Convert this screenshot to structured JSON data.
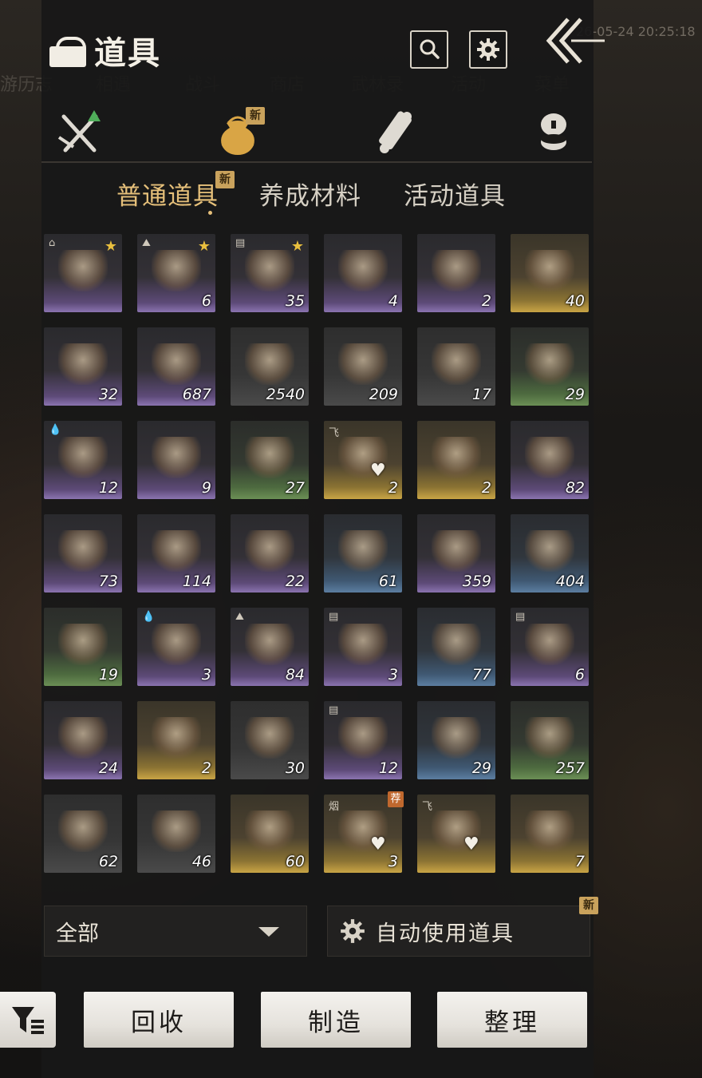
{
  "background": {
    "date_text": "26-05-24 20:25:18",
    "nav_items": [
      "游历志",
      "相遇",
      "战斗",
      "商店",
      "武林录",
      "活动",
      "菜单"
    ]
  },
  "header": {
    "title": "道具",
    "search_icon": "search-icon",
    "settings_icon": "gear-icon",
    "back_icon": "double-chevron-left-icon"
  },
  "category_tabs": [
    {
      "icon": "crossed-swords-icon",
      "active": false,
      "badge": ""
    },
    {
      "icon": "pouch-icon",
      "active": true,
      "badge": "新"
    },
    {
      "icon": "scroll-icon",
      "active": false,
      "badge": ""
    },
    {
      "icon": "coin-stack-icon",
      "active": false,
      "badge": ""
    }
  ],
  "sub_tabs": [
    {
      "label": "普通道具",
      "active": true,
      "badge": "新"
    },
    {
      "label": "养成材料",
      "active": false,
      "badge": ""
    },
    {
      "label": "活动道具",
      "active": false,
      "badge": ""
    }
  ],
  "items": [
    {
      "name": "bamboo-slips",
      "count": "",
      "rarity": "purple",
      "star": true,
      "tag": "house"
    },
    {
      "name": "bamboo-slips",
      "count": "6",
      "rarity": "purple",
      "star": true,
      "tag": "mountain"
    },
    {
      "name": "manual-page",
      "count": "35",
      "rarity": "purple",
      "star": true,
      "tag": "book"
    },
    {
      "name": "magnifier-chest",
      "count": "4",
      "rarity": "purple",
      "star": false,
      "tag": ""
    },
    {
      "name": "lantern-chest",
      "count": "2",
      "rarity": "purple",
      "star": false,
      "tag": ""
    },
    {
      "name": "treasure-chest",
      "count": "40",
      "rarity": "gold",
      "star": false,
      "tag": ""
    },
    {
      "name": "ornate-token",
      "count": "32",
      "rarity": "purple",
      "star": false,
      "tag": ""
    },
    {
      "name": "carved-chest",
      "count": "687",
      "rarity": "purple",
      "star": false,
      "tag": ""
    },
    {
      "name": "firewood",
      "count": "2540",
      "rarity": "grey",
      "star": false,
      "tag": ""
    },
    {
      "name": "iron-ore",
      "count": "209",
      "rarity": "grey",
      "star": false,
      "tag": ""
    },
    {
      "name": "animal-pelt",
      "count": "17",
      "rarity": "grey",
      "star": false,
      "tag": ""
    },
    {
      "name": "gravel-pile",
      "count": "29",
      "rarity": "green",
      "star": false,
      "tag": ""
    },
    {
      "name": "dumpling-soup",
      "count": "12",
      "rarity": "purple",
      "star": false,
      "tag": "drop"
    },
    {
      "name": "fabric-box",
      "count": "9",
      "rarity": "purple",
      "star": false,
      "tag": ""
    },
    {
      "name": "jade-pendant",
      "count": "27",
      "rarity": "green",
      "star": false,
      "tag": ""
    },
    {
      "name": "gift-chest",
      "count": "2",
      "rarity": "gold",
      "star": false,
      "tag": "飞",
      "heart": true
    },
    {
      "name": "spirit-shard",
      "count": "2",
      "rarity": "gold",
      "star": false,
      "tag": ""
    },
    {
      "name": "wardrobe-chest",
      "count": "82",
      "rarity": "purple",
      "star": false,
      "tag": ""
    },
    {
      "name": "soap-box",
      "count": "73",
      "rarity": "purple",
      "star": false,
      "tag": ""
    },
    {
      "name": "wardrobe-chest",
      "count": "114",
      "rarity": "purple",
      "star": false,
      "tag": ""
    },
    {
      "name": "red-envelope",
      "count": "22",
      "rarity": "purple",
      "star": false,
      "tag": ""
    },
    {
      "name": "painting-scroll",
      "count": "61",
      "rarity": "blue",
      "star": false,
      "tag": ""
    },
    {
      "name": "crane-medallion",
      "count": "359",
      "rarity": "purple",
      "star": false,
      "tag": ""
    },
    {
      "name": "dye-box",
      "count": "404",
      "rarity": "blue",
      "star": false,
      "tag": ""
    },
    {
      "name": "plum-blossom",
      "count": "19",
      "rarity": "green",
      "star": false,
      "tag": ""
    },
    {
      "name": "braised-dish",
      "count": "3",
      "rarity": "purple",
      "star": false,
      "tag": "drop"
    },
    {
      "name": "clay-pot-stew",
      "count": "84",
      "rarity": "purple",
      "star": false,
      "tag": "mountain"
    },
    {
      "name": "manual-page",
      "count": "3",
      "rarity": "purple",
      "star": false,
      "tag": "book"
    },
    {
      "name": "war-horn",
      "count": "77",
      "rarity": "blue",
      "star": false,
      "tag": ""
    },
    {
      "name": "manual-page",
      "count": "6",
      "rarity": "purple",
      "star": false,
      "tag": "book"
    },
    {
      "name": "seal-plaque",
      "count": "24",
      "rarity": "purple",
      "star": false,
      "tag": ""
    },
    {
      "name": "spirit-shard",
      "count": "2",
      "rarity": "gold",
      "star": false,
      "tag": ""
    },
    {
      "name": "wine-jar",
      "count": "30",
      "rarity": "grey",
      "star": false,
      "tag": ""
    },
    {
      "name": "manual-page",
      "count": "12",
      "rarity": "purple",
      "star": false,
      "tag": "book"
    },
    {
      "name": "porcelain-jar",
      "count": "29",
      "rarity": "blue",
      "star": false,
      "tag": ""
    },
    {
      "name": "purple-petals",
      "count": "257",
      "rarity": "green",
      "star": false,
      "tag": ""
    },
    {
      "name": "wild-fruit",
      "count": "62",
      "rarity": "grey",
      "star": false,
      "tag": ""
    },
    {
      "name": "seed-sack",
      "count": "46",
      "rarity": "grey",
      "star": false,
      "tag": ""
    },
    {
      "name": "treasure-chest",
      "count": "60",
      "rarity": "gold",
      "star": false,
      "tag": ""
    },
    {
      "name": "gift-chest",
      "count": "3",
      "rarity": "gold",
      "star": false,
      "tag": "烟",
      "heart": true,
      "rec": "荐"
    },
    {
      "name": "gift-chest",
      "count": "",
      "rarity": "gold",
      "star": false,
      "tag": "飞",
      "heart": true
    },
    {
      "name": "treasure-chest",
      "count": "7",
      "rarity": "gold",
      "star": false,
      "tag": ""
    }
  ],
  "filter": {
    "dropdown_value": "全部",
    "auto_use_label": "自动使用道具",
    "auto_use_badge": "新"
  },
  "actions": {
    "filter_icon": "filter-list-icon",
    "recycle_label": "回收",
    "craft_label": "制造",
    "sort_label": "整理"
  },
  "colors": {
    "accent": "#e6c07a",
    "badge": "#c9a25c",
    "star": "#e9bf3e"
  }
}
